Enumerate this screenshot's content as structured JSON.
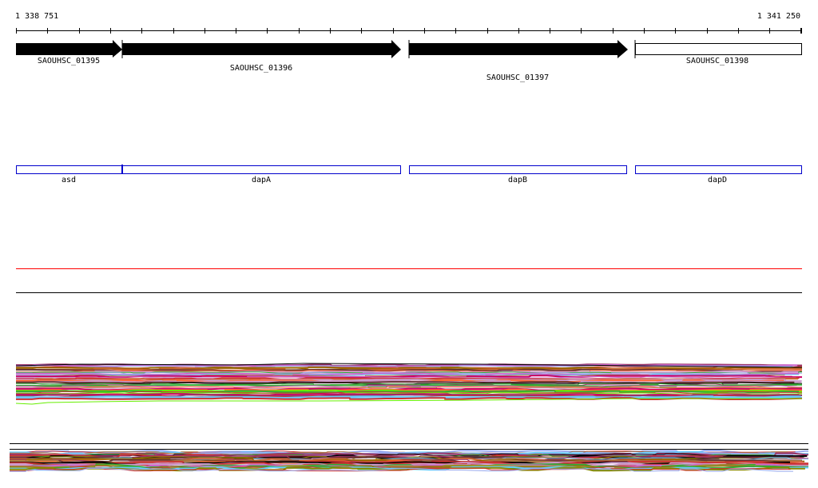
{
  "ruler": {
    "start_label": "1 338 751",
    "end_label": "1 341 250"
  },
  "genes": [
    {
      "locus": "SAOUHSC_01395",
      "name": "asd",
      "strand": "+",
      "filled": true
    },
    {
      "locus": "SAOUHSC_01396",
      "name": "dapA",
      "strand": "+",
      "filled": true
    },
    {
      "locus": "SAOUHSC_01397",
      "name": "dapB",
      "strand": "+",
      "filled": true
    },
    {
      "locus": "SAOUHSC_01398",
      "name": "dapD",
      "strand": "+",
      "filled": false
    }
  ],
  "colors": {
    "gene_fill": "#000000",
    "feature_outline": "#0000cc",
    "red_track": "#ff0000",
    "palette": [
      "#000000",
      "#cc6633",
      "#993366",
      "#cc3333",
      "#996600",
      "#663333",
      "#cc99cc",
      "#999933",
      "#66ccff",
      "#99aaee",
      "#66ee00",
      "#cc0066",
      "#ff6633",
      "#888800",
      "#aa7744",
      "#cc66cc",
      "#33aa33"
    ]
  }
}
